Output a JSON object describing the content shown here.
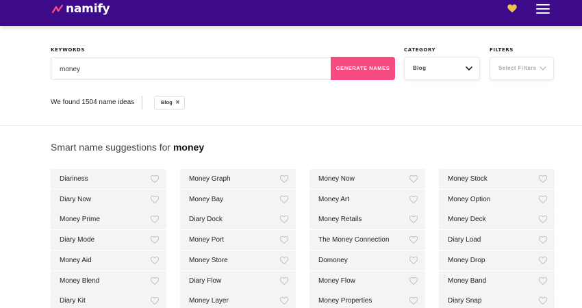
{
  "header": {
    "logo_text": "namify",
    "brand_color": "#3d0a8a",
    "accent_color": "#f54b80",
    "favorite_icon": "heart-icon",
    "menu_icon": "hamburger-menu-icon"
  },
  "search": {
    "keywords_label": "KEYWORDS",
    "keyword_value": "money",
    "generate_label": "GENERATE NAMES",
    "category_label": "CATEGORY",
    "category_value": "Blog",
    "filters_label": "FILTERS",
    "filters_placeholder": "Select Filters"
  },
  "results": {
    "found_text": "We found 1504 name ideas",
    "active_tag": "Blog",
    "title_prefix": "Smart name suggestions for",
    "title_keyword": "money",
    "columns": [
      [
        "Diariness",
        "Diary Now",
        "Money Prime",
        "Diary Mode",
        "Money Aid",
        "Money Blend",
        "Diary Kit"
      ],
      [
        "Money Graph",
        "Money Bay",
        "Diary Dock",
        "Money Port",
        "Money Store",
        "Diary Flow",
        "Money Layer"
      ],
      [
        "Money Now",
        "Money Art",
        "Money Retails",
        "The Money Connection",
        "Domoney",
        "Money Flow",
        "Money Properties"
      ],
      [
        "Money Stock",
        "Money Option",
        "Money Deck",
        "Diary Load",
        "Money Drop",
        "Money Band",
        "Diary Snap"
      ]
    ]
  }
}
